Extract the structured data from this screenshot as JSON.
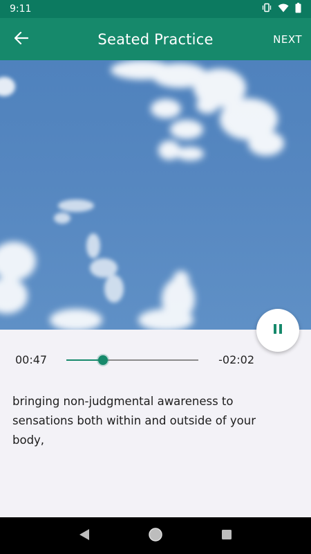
{
  "status_bar": {
    "time": "9:11",
    "icons": [
      "vibrate-icon",
      "wifi-icon",
      "battery-icon"
    ]
  },
  "app_bar": {
    "title": "Seated Practice",
    "next_label": "NEXT",
    "back_icon": "arrow-left-icon"
  },
  "hero": {
    "image": "blue-sky-with-clouds"
  },
  "player": {
    "elapsed": "00:47",
    "remaining": "-02:02",
    "progress": 0.28,
    "pause_icon": "pause-icon",
    "caption": "bringing non-judgmental awareness to sensations both within and outside of your body,"
  },
  "nav_bar": {
    "buttons": [
      "back-triangle-icon",
      "home-circle-icon",
      "recents-square-icon"
    ]
  },
  "colors": {
    "primary": "#16896b",
    "primary_dark": "#0c7a60",
    "sky": "#5687c0",
    "background": "#f3f2f7"
  }
}
